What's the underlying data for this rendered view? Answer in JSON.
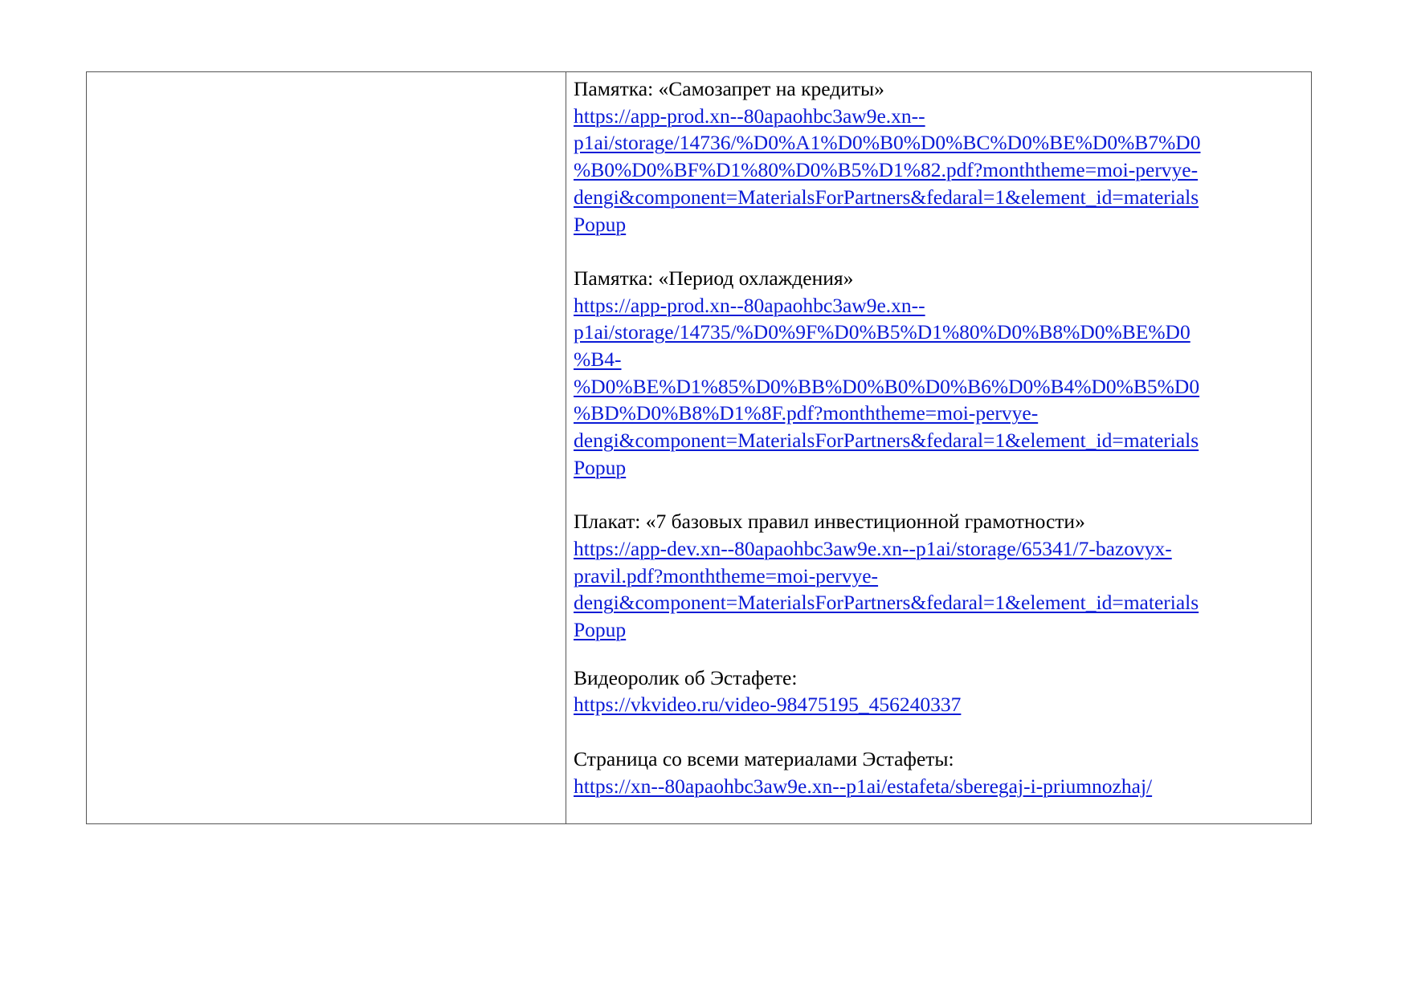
{
  "document": {
    "entries": [
      {
        "title": "Памятка: «Самозапрет на кредиты»",
        "link_lines": [
          "https://app-prod.xn--80apaohbc3aw9e.xn--",
          "p1ai/storage/14736/%D0%A1%D0%B0%D0%BC%D0%BE%D0%B7%D0",
          "%B0%D0%BF%D1%80%D0%B5%D1%82.pdf?monththeme=moi-pervye-",
          "dengi&component=MaterialsForPartners&fedaral=1&element_id=materials",
          "Popup"
        ]
      },
      {
        "title": "Памятка: «Период охлаждения»",
        "link_lines": [
          "https://app-prod.xn--80apaohbc3aw9e.xn--",
          "p1ai/storage/14735/%D0%9F%D0%B5%D1%80%D0%B8%D0%BE%D0",
          "%B4-",
          "%D0%BE%D1%85%D0%BB%D0%B0%D0%B6%D0%B4%D0%B5%D0",
          "%BD%D0%B8%D1%8F.pdf?monththeme=moi-pervye-",
          "dengi&component=MaterialsForPartners&fedaral=1&element_id=materials",
          "Popup"
        ]
      },
      {
        "title": "Плакат: «7 базовых правил инвестиционной грамотности»",
        "link_lines": [
          "https://app-dev.xn--80apaohbc3aw9e.xn--p1ai/storage/65341/7-bazovyx-",
          "pravil.pdf?monththeme=moi-pervye-",
          "dengi&component=MaterialsForPartners&fedaral=1&element_id=materials",
          "Popup"
        ]
      },
      {
        "title": "Видеоролик об Эстафете:",
        "link_lines": [
          "https://vkvideo.ru/video-98475195_456240337"
        ]
      },
      {
        "title": "Страница со всеми материалами Эстафеты:",
        "link_lines": [
          "https://xn--80apaohbc3aw9e.xn--p1ai/estafeta/sberegaj-i-priumnozhaj/"
        ]
      }
    ]
  },
  "colors": {
    "link": "#0b1bd6",
    "text": "#000000",
    "border": "#555555"
  }
}
